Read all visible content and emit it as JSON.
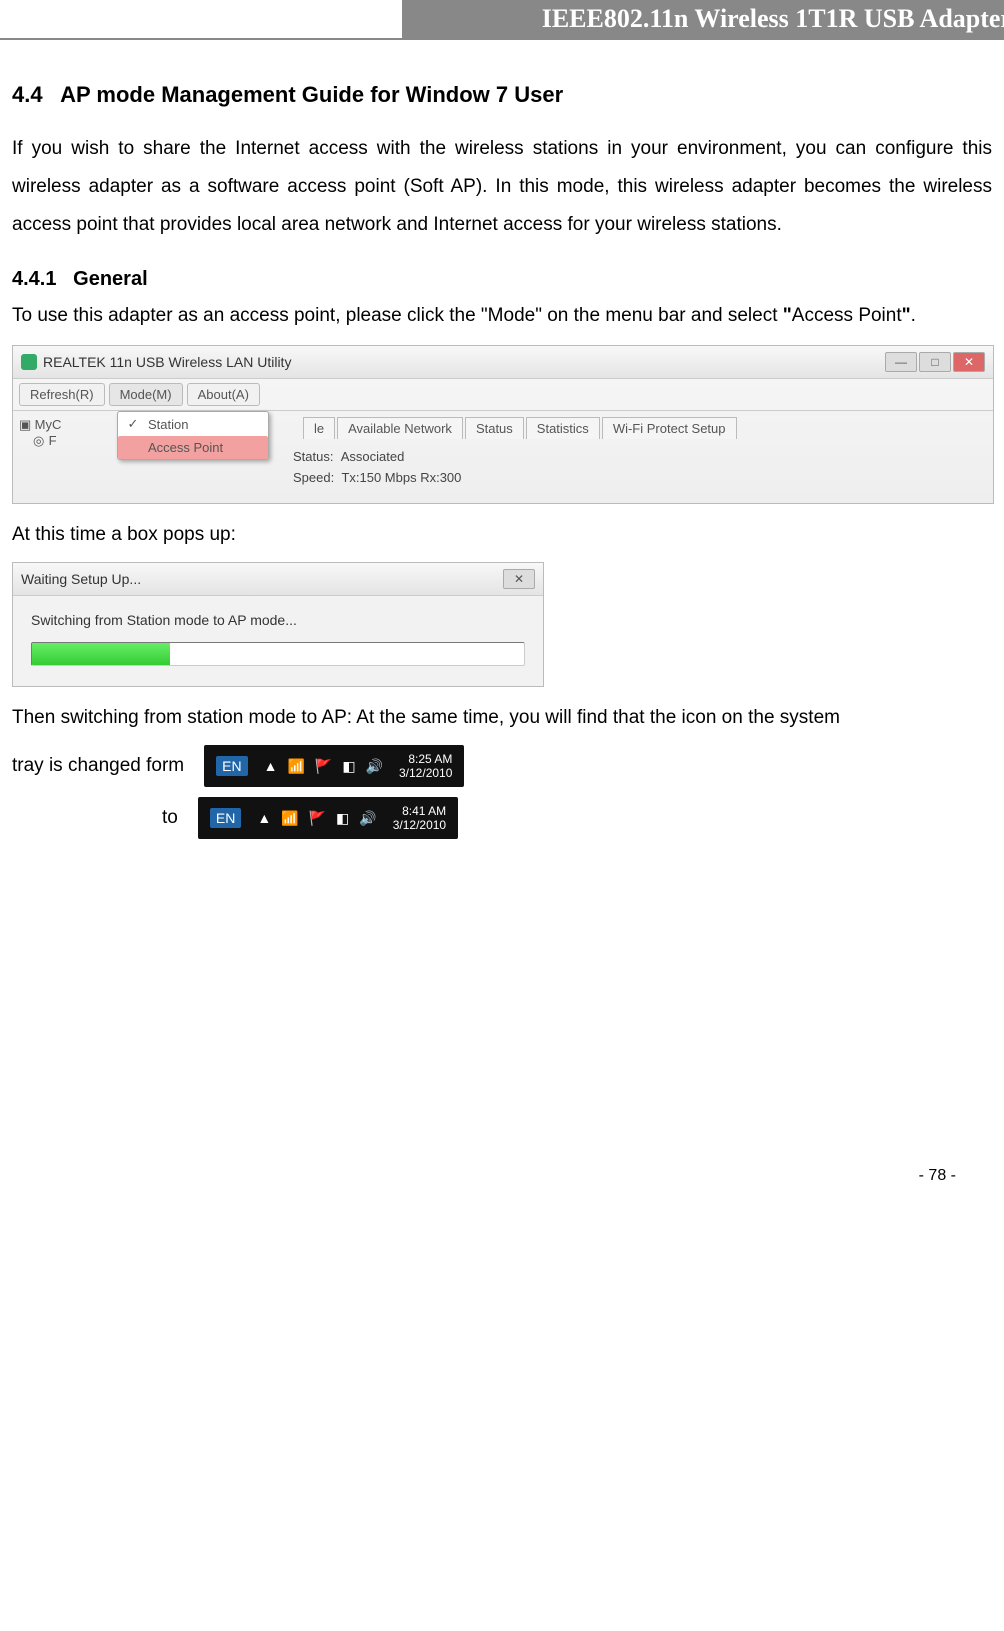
{
  "header": {
    "title": "IEEE802.11n Wireless 1T1R USB Adapter"
  },
  "section": {
    "number": "4.4",
    "title": "AP mode Management Guide for Window 7 User",
    "intro": "If you wish to share the Internet access with the wireless stations in your environment, you can configure this wireless adapter as a software access point (Soft AP). In this mode, this wireless adapter becomes the wireless access point that provides local area network and Internet access for your wireless stations."
  },
  "sub441": {
    "number": "4.4.1",
    "title": "General",
    "lead_pre": "To use this adapter as an access point, please click the \"Mode\" on the menu bar and select ",
    "lead_quote_open": "\"",
    "lead_term": "Access Point",
    "lead_quote_close": "\"",
    "lead_period": "."
  },
  "fig1": {
    "window_title": "REALTEK 11n USB Wireless LAN Utility",
    "menu": {
      "refresh": "Refresh(R)",
      "mode": "Mode(M)",
      "about": "About(A)"
    },
    "mode_menu": {
      "station": "Station",
      "access_point": "Access Point",
      "check_glyph": "✓"
    },
    "sidebar": {
      "myc": "MyC",
      "f": "F"
    },
    "tabs": [
      "le",
      "Available Network",
      "Status",
      "Statistics",
      "Wi-Fi Protect Setup"
    ],
    "status_lbl": "Status:",
    "status_val": "Associated",
    "speed_lbl": "Speed:",
    "speed_val": "Tx:150 Mbps Rx:300",
    "win_min": "—",
    "win_max": "□",
    "win_close": "✕"
  },
  "after_fig1": "At this time a box pops up:",
  "fig2": {
    "title": "Waiting Setup Up...",
    "msg": "Switching from Station mode to AP mode...",
    "close_glyph": "✕"
  },
  "after_fig2": "Then switching from station mode to AP: At the same time, you will find that the icon on the system",
  "tray_line1_label": "tray is changed form",
  "tray_line2_label": "to",
  "tray1": {
    "lang": "EN",
    "up": "▲",
    "net": "📶",
    "flag": "🚩",
    "misc": "◧",
    "vol": "🔊",
    "time": "8:25 AM",
    "date": "3/12/2010"
  },
  "tray2": {
    "lang": "EN",
    "up": "▲",
    "net": "📶",
    "flag": "🚩",
    "misc": "◧",
    "vol": "🔊",
    "time": "8:41 AM",
    "date": "3/12/2010"
  },
  "page_number": "- 78 -"
}
